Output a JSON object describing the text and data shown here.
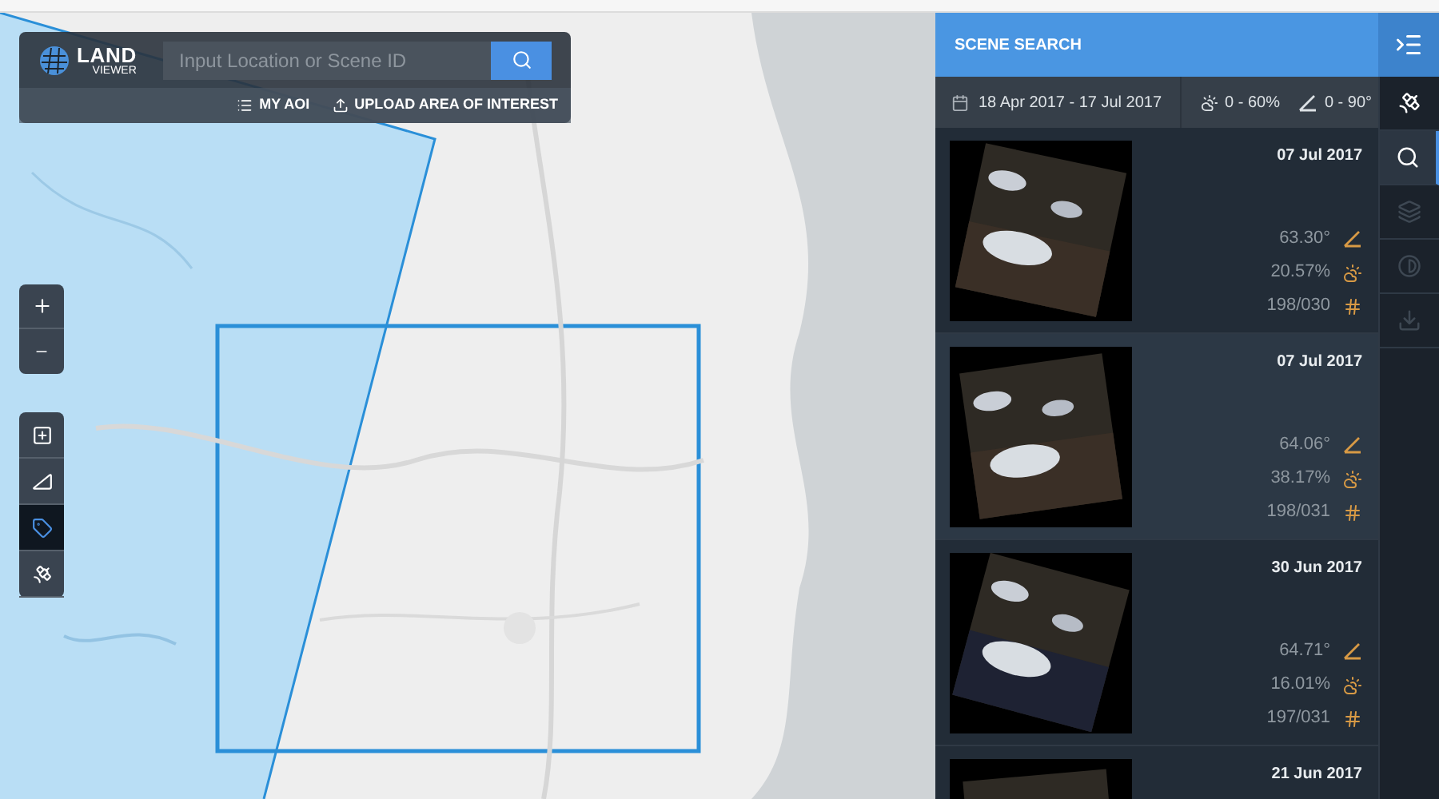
{
  "search": {
    "logo_top": "LAND",
    "logo_bottom": "VIEWER",
    "placeholder": "Input Location or Scene ID",
    "links": [
      "MY AOI",
      "UPLOAD AREA OF INTEREST"
    ]
  },
  "map_tools": [
    {
      "kind": "draw",
      "selected": false
    },
    {
      "kind": "ruler",
      "selected": false
    },
    {
      "kind": "tag",
      "selected": true
    },
    {
      "kind": "satellite",
      "selected": false
    }
  ],
  "panel": {
    "title": "SCENE SEARCH",
    "date_range": "18 Apr 2017 - 17 Jul 2017",
    "cloud_range": "0 - 60%",
    "angle_range": "0 - 90°"
  },
  "scenes": [
    {
      "date": "07 Jul 2017",
      "angle": "63.30°",
      "cloud": "20.57%",
      "path_row": "198/030",
      "selected": false
    },
    {
      "date": "07 Jul 2017",
      "angle": "64.06°",
      "cloud": "38.17%",
      "path_row": "198/031",
      "selected": true
    },
    {
      "date": "30 Jun 2017",
      "angle": "64.71°",
      "cloud": "16.01%",
      "path_row": "197/031",
      "selected": false
    },
    {
      "date": "21 Jun 2017",
      "selected": false
    }
  ],
  "rail": [
    {
      "kind": "satellite",
      "selected": false,
      "disabled": false
    },
    {
      "kind": "search",
      "selected": true,
      "disabled": false
    },
    {
      "kind": "layers",
      "selected": false,
      "disabled": true
    },
    {
      "kind": "contrast",
      "selected": false,
      "disabled": true
    },
    {
      "kind": "download",
      "selected": false,
      "disabled": true
    }
  ]
}
